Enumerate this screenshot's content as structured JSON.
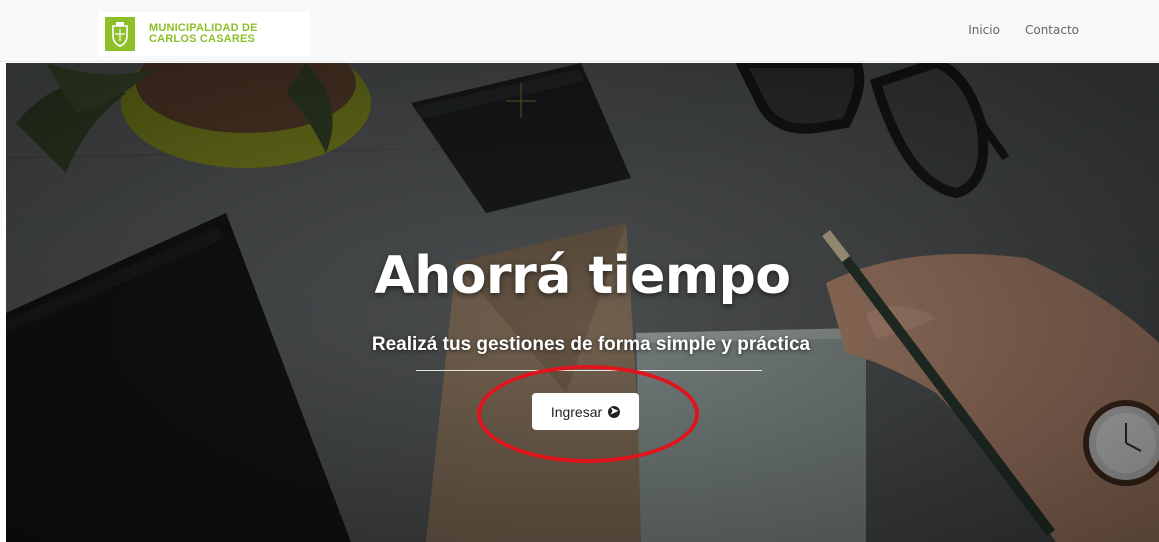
{
  "header": {
    "brand_line1": "MUNICIPALIDAD DE",
    "brand_line2": "CARLOS CASARES",
    "nav": [
      {
        "label": "Inicio"
      },
      {
        "label": "Contacto"
      }
    ]
  },
  "hero": {
    "title": "Ahorrá tiempo",
    "subtitle": "Realizá tus gestiones de forma simple y práctica",
    "cta_label": "Ingresar",
    "cta_icon": "arrow-circle-right-icon"
  },
  "colors": {
    "brand_green": "#8cbf2a",
    "annotation_red": "#e0141c",
    "nav_text": "#666666"
  }
}
